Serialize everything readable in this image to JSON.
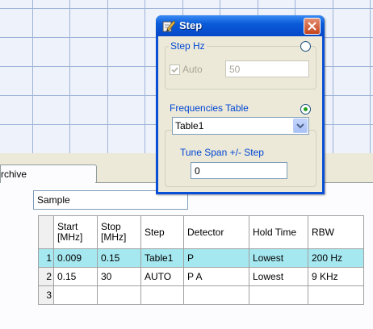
{
  "dialog": {
    "title": "Step",
    "step_hz": {
      "label": "Step Hz",
      "auto_label": "Auto",
      "auto_checked": true,
      "value": "50",
      "selected": false
    },
    "frequencies_table": {
      "label": "Frequencies Table",
      "selected": true,
      "combo_value": "Table1"
    },
    "tune_span": {
      "label": "Tune Span +/- Step",
      "value": "0"
    }
  },
  "tab": {
    "label": "rchive"
  },
  "sample_field": {
    "value": "Sample"
  },
  "table": {
    "columns": [
      "Start\n[MHz]",
      "Stop\n[MHz]",
      "Step",
      "Detector",
      "Hold Time",
      "RBW"
    ],
    "columns_display": [
      [
        "Start",
        "[MHz]"
      ],
      [
        "Stop",
        "[MHz]"
      ],
      [
        "Step"
      ],
      [
        "Detector"
      ],
      [
        "Hold Time"
      ],
      [
        "RBW"
      ]
    ],
    "rows": [
      {
        "num": "1",
        "start": "0.009",
        "stop": "0.15",
        "step": "Table1",
        "detector": "P",
        "hold": "Lowest",
        "rbw": "200 Hz",
        "selected": true
      },
      {
        "num": "2",
        "start": "0.15",
        "stop": "30",
        "step": "AUTO",
        "detector": "P A",
        "hold": "Lowest",
        "rbw": "9 KHz",
        "selected": false
      },
      {
        "num": "3",
        "start": "",
        "stop": "",
        "step": "",
        "detector": "",
        "hold": "",
        "rbw": "",
        "selected": false
      }
    ]
  },
  "colors": {
    "title_bar": "#0b5bd8",
    "selected_row": "#a6e8f0",
    "group_label": "#0046d5",
    "grid_lines": "#9fb3d8"
  }
}
